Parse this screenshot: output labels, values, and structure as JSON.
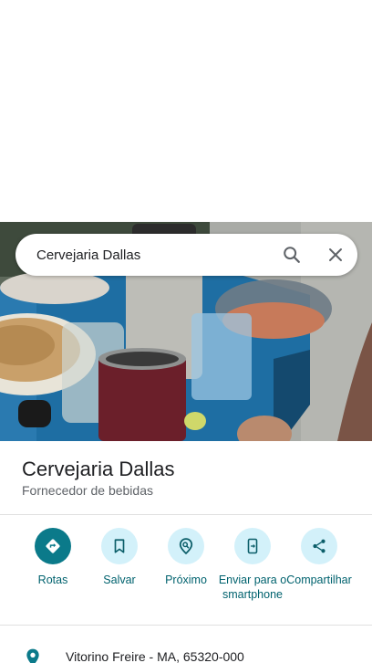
{
  "search": {
    "query": "Cervejaria Dallas"
  },
  "place": {
    "name": "Cervejaria Dallas",
    "category": "Fornecedor de bebidas"
  },
  "actions": [
    {
      "label": "Rotas",
      "icon": "directions-icon"
    },
    {
      "label": "Salvar",
      "icon": "bookmark-icon"
    },
    {
      "label": "Próximo",
      "icon": "nearby-icon"
    },
    {
      "label": "Enviar para o smartphone",
      "icon": "send-to-phone-icon"
    },
    {
      "label": "Compartilhar",
      "icon": "share-icon"
    }
  ],
  "address": {
    "text": "Vitorino Freire - MA, 65320-000"
  },
  "colors": {
    "accent": "#0b7a8a",
    "action_bg": "#d3f1fa",
    "action_text": "#00626e"
  }
}
